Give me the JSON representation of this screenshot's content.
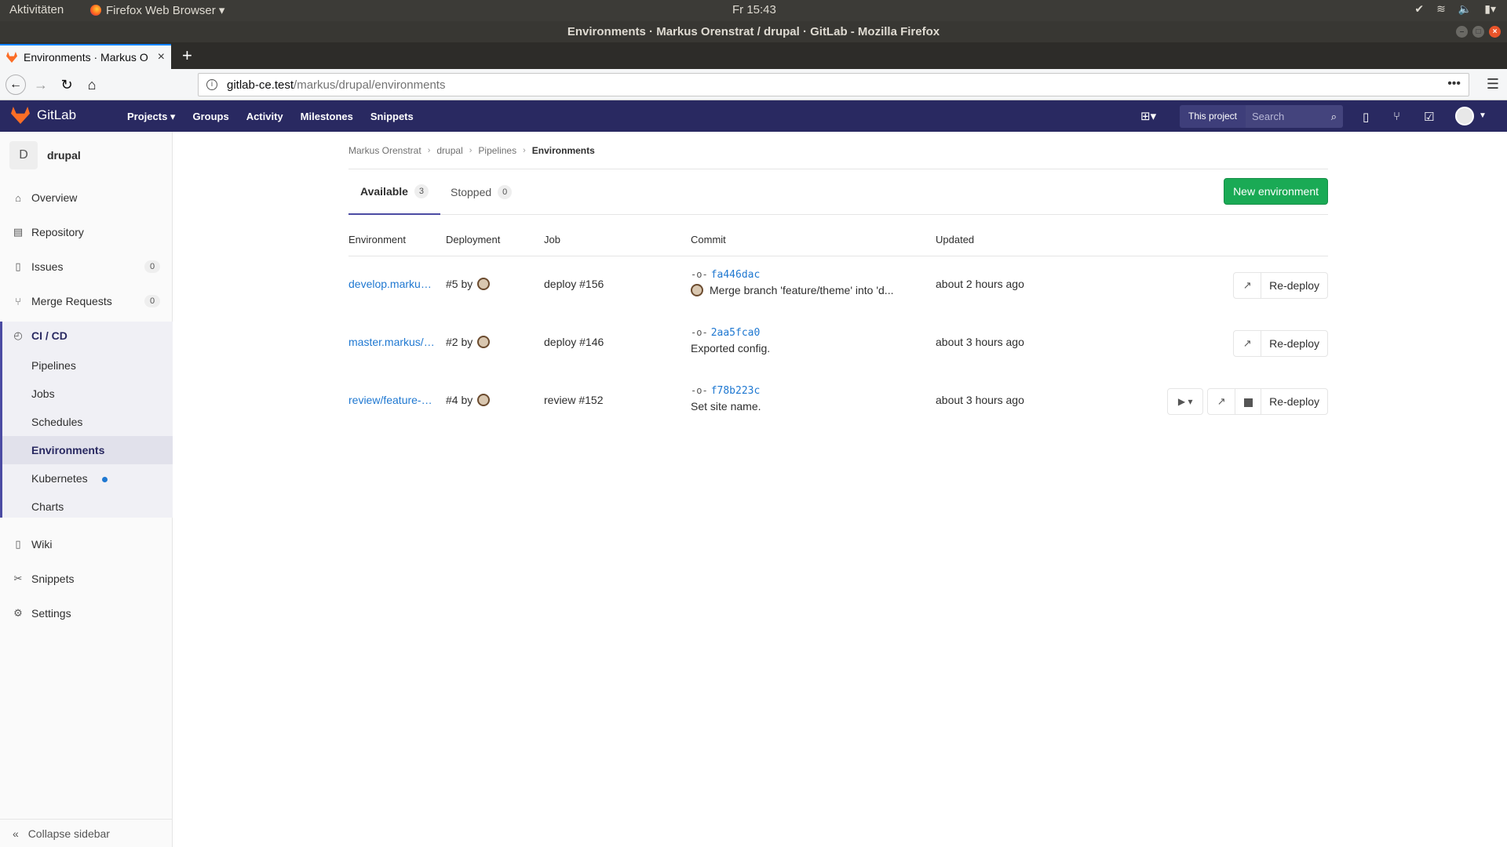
{
  "os": {
    "activities": "Aktivitäten",
    "app_menu": "Firefox Web Browser ▾",
    "clock": "Fr 15:43"
  },
  "window": {
    "title": "Environments · Markus Orenstrat / drupal · GitLab - Mozilla Firefox"
  },
  "browser": {
    "tab_title": "Environments · Markus O",
    "url_host": "gitlab-ce.test",
    "url_path": "/markus/drupal/environments"
  },
  "gitlab": {
    "brand": "GitLab",
    "nav": [
      "Projects ▾",
      "Groups",
      "Activity",
      "Milestones",
      "Snippets"
    ],
    "search_scope": "This project",
    "search_placeholder": "Search"
  },
  "sidebar": {
    "project_initial": "D",
    "project_name": "drupal",
    "items": [
      {
        "label": "Overview",
        "icon": "home-icon"
      },
      {
        "label": "Repository",
        "icon": "repo-icon"
      },
      {
        "label": "Issues",
        "icon": "issues-icon",
        "count": "0"
      },
      {
        "label": "Merge Requests",
        "icon": "merge-request-icon",
        "count": "0"
      },
      {
        "label": "CI / CD",
        "icon": "rocket-icon"
      },
      {
        "label": "Wiki",
        "icon": "book-icon"
      },
      {
        "label": "Snippets",
        "icon": "scissors-icon"
      },
      {
        "label": "Settings",
        "icon": "gear-icon"
      }
    ],
    "cicd_sub": [
      "Pipelines",
      "Jobs",
      "Schedules",
      "Environments",
      "Kubernetes",
      "Charts"
    ],
    "collapse": "Collapse sidebar"
  },
  "breadcrumb": [
    "Markus Orenstrat",
    "drupal",
    "Pipelines",
    "Environments"
  ],
  "tabs": {
    "available_label": "Available",
    "available_count": "3",
    "stopped_label": "Stopped",
    "stopped_count": "0",
    "new_button": "New environment"
  },
  "table": {
    "headers": [
      "Environment",
      "Deployment",
      "Job",
      "Commit",
      "Updated"
    ],
    "rows": [
      {
        "env": "develop.markus/drupal",
        "deployment": "#5 by",
        "job": "deploy #156",
        "sha": "fa446dac",
        "message": "Merge branch 'feature/theme' into 'd...",
        "updated": "about 2 hours ago",
        "redeploy": "Re-deploy"
      },
      {
        "env": "master.markus/drupal",
        "deployment": "#2 by",
        "job": "deploy #146",
        "sha": "2aa5fca0",
        "message": "Exported config.",
        "updated": "about 3 hours ago",
        "redeploy": "Re-deploy"
      },
      {
        "env": "review/feature-site-name",
        "deployment": "#4 by",
        "job": "review #152",
        "sha": "f78b223c",
        "message": "Set site name.",
        "updated": "about 3 hours ago",
        "redeploy": "Re-deploy"
      }
    ]
  }
}
